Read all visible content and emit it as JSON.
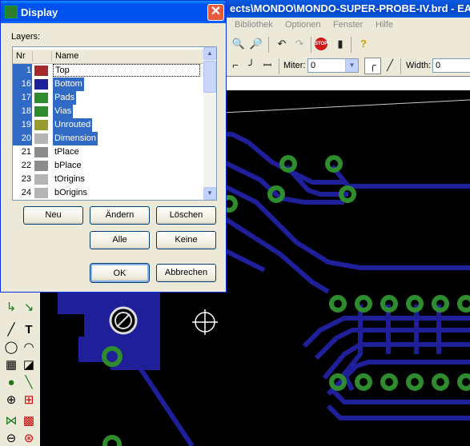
{
  "app": {
    "title": "ects\\MONDO\\MONDO-SUPER-PROBE-IV.brd - EAGLE",
    "menu": [
      "Bibliothek",
      "Optionen",
      "Fenster",
      "Hilfe"
    ],
    "toolbar": {
      "stop_label": "STOP",
      "miter_label": "Miter:",
      "miter_value": "0",
      "width_label": "Width:",
      "width_value": "0"
    }
  },
  "dialog": {
    "title": "Display",
    "close_glyph": "✕",
    "layers_label": "Layers:",
    "columns": [
      "Nr",
      "Name"
    ],
    "layers": [
      {
        "nr": "1",
        "name": "Top",
        "color": "#a52a2a",
        "selected": true,
        "focused": true
      },
      {
        "nr": "16",
        "name": "Bottom",
        "color": "#1f1f9a",
        "selected": true
      },
      {
        "nr": "17",
        "name": "Pads",
        "color": "#2e8b2e",
        "selected": true
      },
      {
        "nr": "18",
        "name": "Vias",
        "color": "#2e8b2e",
        "selected": true
      },
      {
        "nr": "19",
        "name": "Unrouted",
        "color": "#9a9a2e",
        "selected": true
      },
      {
        "nr": "20",
        "name": "Dimension",
        "color": "#b4b4b4",
        "selected": true
      },
      {
        "nr": "21",
        "name": "tPlace",
        "color": "#8c8c8c",
        "selected": false
      },
      {
        "nr": "22",
        "name": "bPlace",
        "color": "#8c8c8c",
        "selected": false
      },
      {
        "nr": "23",
        "name": "tOrigins",
        "color": "#b4b4b4",
        "selected": false
      },
      {
        "nr": "24",
        "name": "bOrigins",
        "color": "#b4b4b4",
        "selected": false
      }
    ],
    "buttons": {
      "new": "Neu",
      "change": "Ändern",
      "delete": "Löschen",
      "all": "Alle",
      "none": "Keine",
      "ok": "OK",
      "cancel": "Abbrechen"
    }
  },
  "colors": {
    "canvas_bg": "#000000",
    "trace": "#1f1f9a",
    "pad": "#2e8b2e",
    "selection": "#316ac5"
  }
}
